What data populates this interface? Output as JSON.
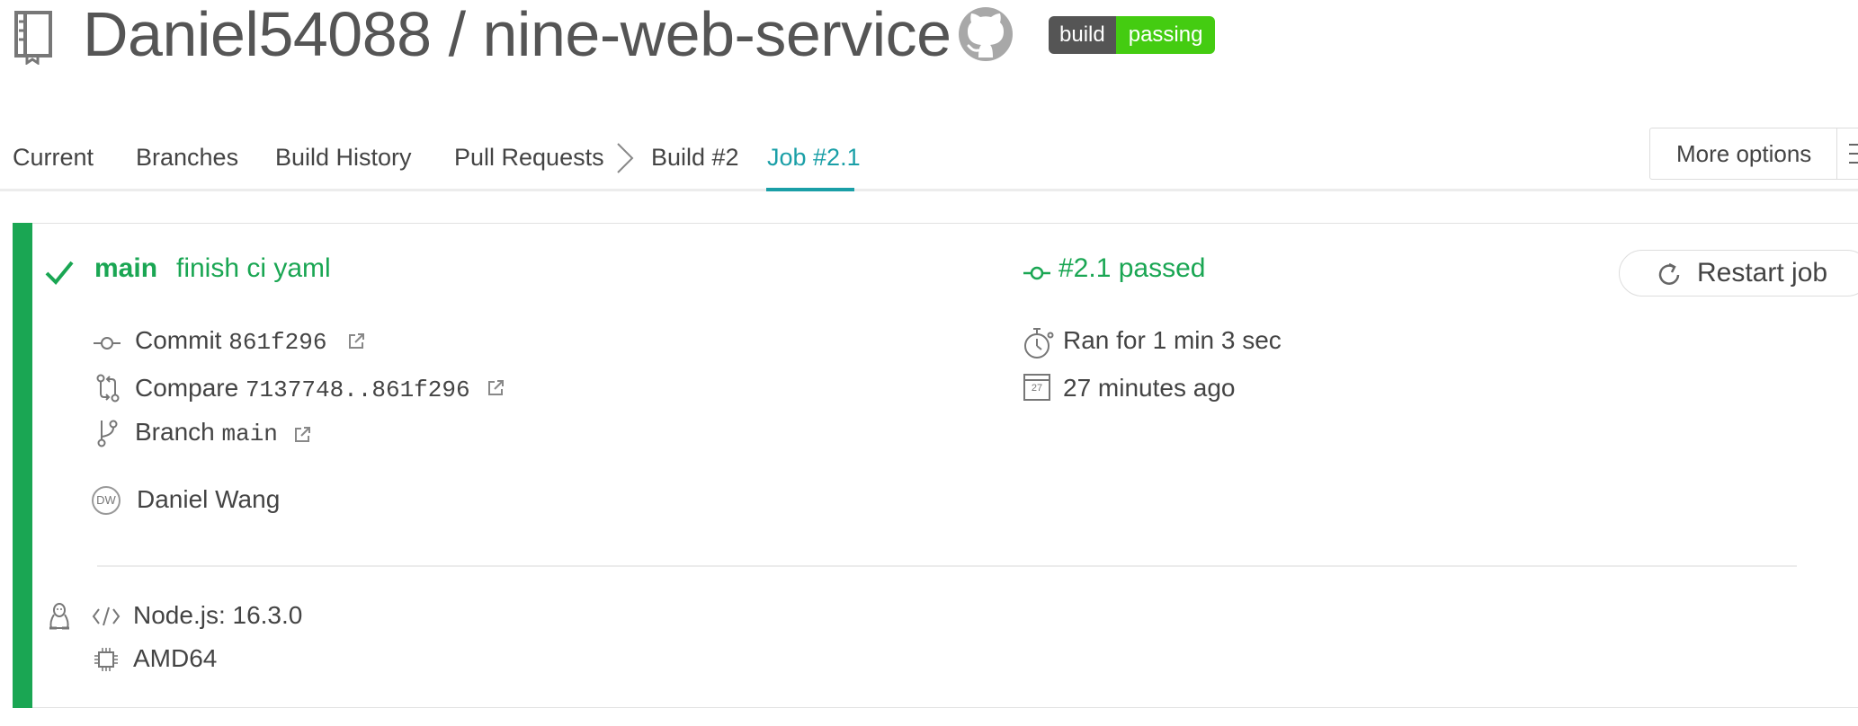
{
  "header": {
    "owner": "Daniel54088",
    "separator": "/",
    "repo": "nine-web-service",
    "badge": {
      "left": "build",
      "right": "passing"
    }
  },
  "tabs": {
    "items": [
      "Current",
      "Branches",
      "Build History",
      "Pull Requests"
    ],
    "breadcrumb_build": "Build #2",
    "active": "Job #2.1",
    "more_options": "More options"
  },
  "job": {
    "branch": "main",
    "commit_message": "finish ci yaml",
    "status": "#2.1 passed",
    "restart_label": "Restart job",
    "commit_label": "Commit",
    "commit_sha": "861f296",
    "compare_label": "Compare",
    "compare_range": "7137748..861f296",
    "branch_label": "Branch",
    "branch_value": "main",
    "author_initials": "DW",
    "author_name": "Daniel Wang",
    "duration": "Ran for 1 min 3 sec",
    "calendar_day": "27",
    "finished": "27 minutes ago",
    "language": "Node.js: 16.3.0",
    "arch": "AMD64"
  },
  "colors": {
    "passed": "#1aa653",
    "active_tab": "#1a9fa7",
    "badge_left": "#555555",
    "badge_right": "#44cc11"
  }
}
